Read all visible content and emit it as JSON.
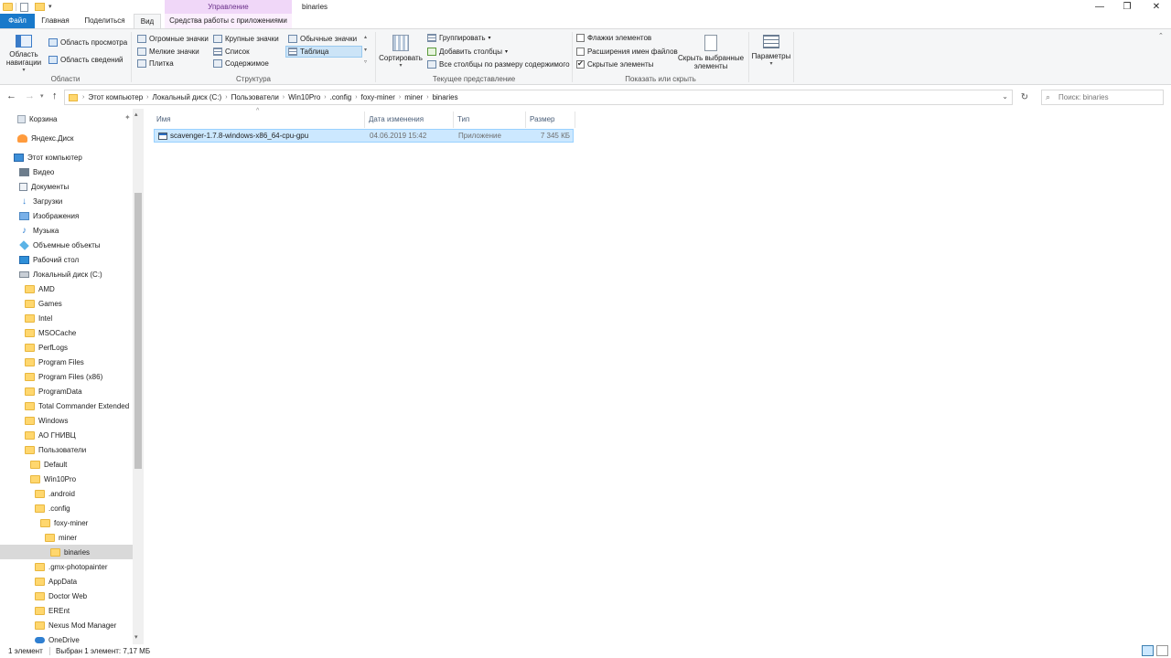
{
  "window": {
    "context_tab_title": "Управление",
    "title": "binaries",
    "minimize": "—",
    "maximize": "❐",
    "close": "✕"
  },
  "quick_access": {
    "dropdown": "▾"
  },
  "tabs": {
    "file": "Файл",
    "home": "Главная",
    "share": "Поделиться",
    "view": "Вид",
    "app_tools": "Средства работы с приложениями"
  },
  "ribbon": {
    "panes": {
      "nav_pane": "Область навигации",
      "preview_pane": "Область просмотра",
      "details_pane": "Область сведений",
      "label": "Области"
    },
    "layout": {
      "huge_icons": "Огромные значки",
      "large_icons": "Крупные значки",
      "normal_icons": "Обычные значки",
      "small_icons": "Мелкие значки",
      "list": "Список",
      "table": "Таблица",
      "tiles": "Плитка",
      "content": "Содержимое",
      "label": "Структура"
    },
    "current_view": {
      "sort": "Сортировать",
      "group_by": "Группировать",
      "add_columns": "Добавить столбцы",
      "fit_columns": "Все столбцы по размеру содержимого",
      "label": "Текущее представление"
    },
    "show_hide": {
      "item_checkboxes": "Флажки элементов",
      "item_checkboxes_checked": false,
      "file_extensions": "Расширения имен файлов",
      "file_extensions_checked": false,
      "hidden_items": "Скрытые элементы",
      "hidden_items_checked": true,
      "hide_selected": "Скрыть выбранные элементы",
      "label": "Показать или скрыть"
    },
    "options": "Параметры"
  },
  "address": {
    "crumbs": [
      "Этот компьютер",
      "Локальный диск (C:)",
      "Пользователи",
      "Win10Pro",
      ".config",
      "foxy-miner",
      "miner",
      "binaries"
    ],
    "search_placeholder": "Поиск: binaries"
  },
  "nav": {
    "items": [
      {
        "label": "Корзина",
        "icon": "trash-icon"
      },
      {
        "label": "Яндекс.Диск",
        "icon": "yandex-disk-icon"
      },
      {
        "label": "Этот компьютер",
        "icon": "computer-icon"
      },
      {
        "label": "Видео",
        "icon": "video-icon"
      },
      {
        "label": "Документы",
        "icon": "documents-icon"
      },
      {
        "label": "Загрузки",
        "icon": "downloads-icon"
      },
      {
        "label": "Изображения",
        "icon": "pictures-icon"
      },
      {
        "label": "Музыка",
        "icon": "music-icon"
      },
      {
        "label": "Объемные объекты",
        "icon": "3d-objects-icon"
      },
      {
        "label": "Рабочий стол",
        "icon": "desktop-icon"
      },
      {
        "label": "Локальный диск (C:)",
        "icon": "drive-icon"
      },
      {
        "label": "AMD",
        "icon": "folder-icon"
      },
      {
        "label": "Games",
        "icon": "folder-icon"
      },
      {
        "label": "Intel",
        "icon": "folder-icon"
      },
      {
        "label": "MSOCache",
        "icon": "folder-icon"
      },
      {
        "label": "PerfLogs",
        "icon": "folder-icon"
      },
      {
        "label": "Program Files",
        "icon": "folder-icon"
      },
      {
        "label": "Program Files (x86)",
        "icon": "folder-icon"
      },
      {
        "label": "ProgramData",
        "icon": "folder-icon"
      },
      {
        "label": "Total Commander Extended",
        "icon": "folder-icon"
      },
      {
        "label": "Windows",
        "icon": "folder-icon"
      },
      {
        "label": "АО ГНИВЦ",
        "icon": "folder-icon"
      },
      {
        "label": "Пользователи",
        "icon": "folder-icon"
      },
      {
        "label": "Default",
        "icon": "folder-icon"
      },
      {
        "label": "Win10Pro",
        "icon": "folder-icon"
      },
      {
        "label": ".android",
        "icon": "folder-icon"
      },
      {
        "label": ".config",
        "icon": "folder-icon"
      },
      {
        "label": "foxy-miner",
        "icon": "folder-icon"
      },
      {
        "label": "miner",
        "icon": "folder-icon"
      },
      {
        "label": "binaries",
        "icon": "folder-icon"
      },
      {
        "label": ".gmx-photopainter",
        "icon": "folder-icon"
      },
      {
        "label": "AppData",
        "icon": "folder-icon"
      },
      {
        "label": "Doctor Web",
        "icon": "folder-icon"
      },
      {
        "label": "EREnt",
        "icon": "folder-icon"
      },
      {
        "label": "Nexus Mod Manager",
        "icon": "folder-icon"
      },
      {
        "label": "OneDrive",
        "icon": "onedrive-icon"
      }
    ]
  },
  "columns": {
    "name": "Имя",
    "date": "Дата изменения",
    "type": "Тип",
    "size": "Размер"
  },
  "files": [
    {
      "name": "scavenger-1.7.8-windows-x86_64-cpu-gpu",
      "date": "04.06.2019 15:42",
      "type": "Приложение",
      "size": "7 345 КБ"
    }
  ],
  "status": {
    "count": "1 элемент",
    "selected": "Выбран 1 элемент: 7,17 МБ"
  }
}
